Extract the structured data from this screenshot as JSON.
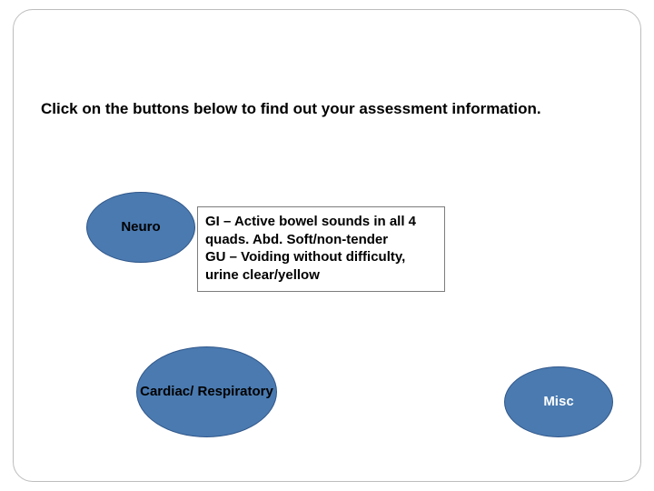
{
  "instruction": "Click on the buttons below to find out your assessment information.",
  "buttons": {
    "neuro": "Neuro",
    "cardiac": "Cardiac/\nRespiratory",
    "misc": "Misc"
  },
  "info_text": "GI – Active bowel sounds in all 4 quads.  Abd. Soft/non-tender\nGU – Voiding without difficulty, urine clear/yellow"
}
